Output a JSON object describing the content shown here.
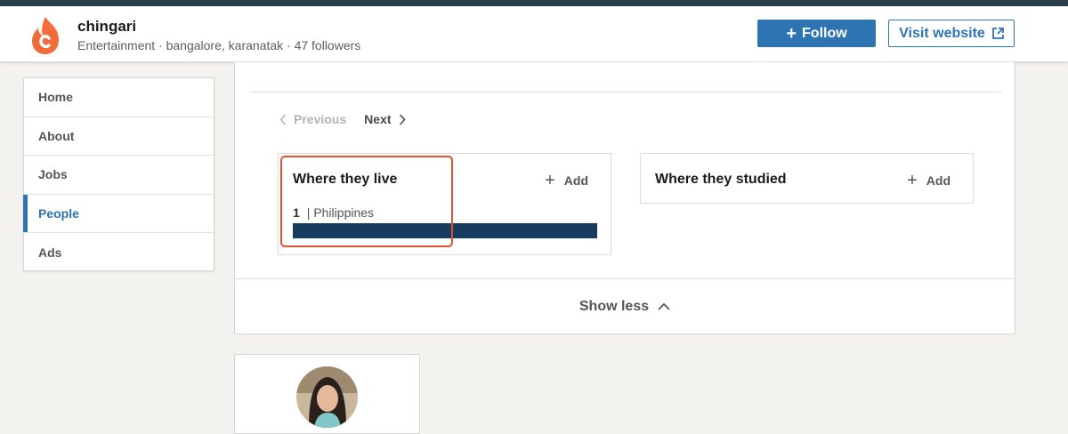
{
  "header": {
    "company_name": "chingari",
    "company_meta": "Entertainment · bangalore, karanatak · 47 followers",
    "follow_label": "Follow",
    "visit_label": "Visit website",
    "logo_icon": "chingari-flame-logo",
    "accent_color": "#2e73b2"
  },
  "sidebar": {
    "items": [
      {
        "label": "Home",
        "active": false
      },
      {
        "label": "About",
        "active": false
      },
      {
        "label": "Jobs",
        "active": false
      },
      {
        "label": "People",
        "active": true
      },
      {
        "label": "Ads",
        "active": false
      }
    ]
  },
  "pager": {
    "previous_label": "Previous",
    "next_label": "Next"
  },
  "insights": {
    "live": {
      "title": "Where they live",
      "add_label": "Add",
      "count": "1",
      "location": "| Philippines",
      "bar_fraction": 1.0
    },
    "studied": {
      "title": "Where they studied",
      "add_label": "Add"
    }
  },
  "footer_toggle": {
    "label": "Show less"
  },
  "highlight_color": "#e3522b"
}
